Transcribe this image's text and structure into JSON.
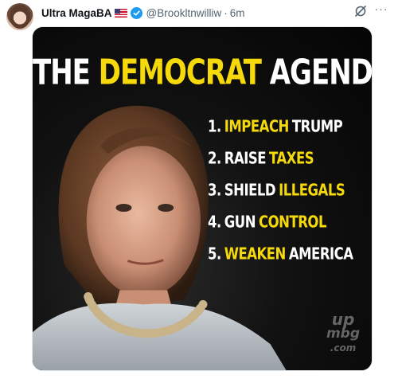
{
  "author": {
    "display_name": "Ultra MagaBA",
    "flag_icon": "us-flag-icon",
    "verified_icon": "verified-badge-icon",
    "handle": "@Brookltnwilliw",
    "separator": "·",
    "time": "6m"
  },
  "actions": {
    "grok_icon": "grok-icon",
    "more_label": "···"
  },
  "media": {
    "headline": {
      "part1": "THE ",
      "part2": "DEMOCRAT",
      "part3": " AGENDA"
    },
    "items": [
      {
        "num": "1.",
        "highlight": "IMPEACH",
        "rest": "TRUMP"
      },
      {
        "num": "2.",
        "rest_before": "RAISE",
        "highlight": "TAXES"
      },
      {
        "num": "3.",
        "rest_before": "SHIELD",
        "highlight": "ILLEGALS"
      },
      {
        "num": "4.",
        "rest_before": "GUN",
        "highlight": "CONTROL"
      },
      {
        "num": "5.",
        "highlight": "WEAKEN",
        "rest": "AMERICA"
      }
    ],
    "watermark_top": "up",
    "watermark_bottom": "mbg",
    "watermark_tail": ".com",
    "colors": {
      "accent_yellow": "#f5d90a",
      "text_white": "#ffffff",
      "background": "#0b0b0b"
    }
  }
}
